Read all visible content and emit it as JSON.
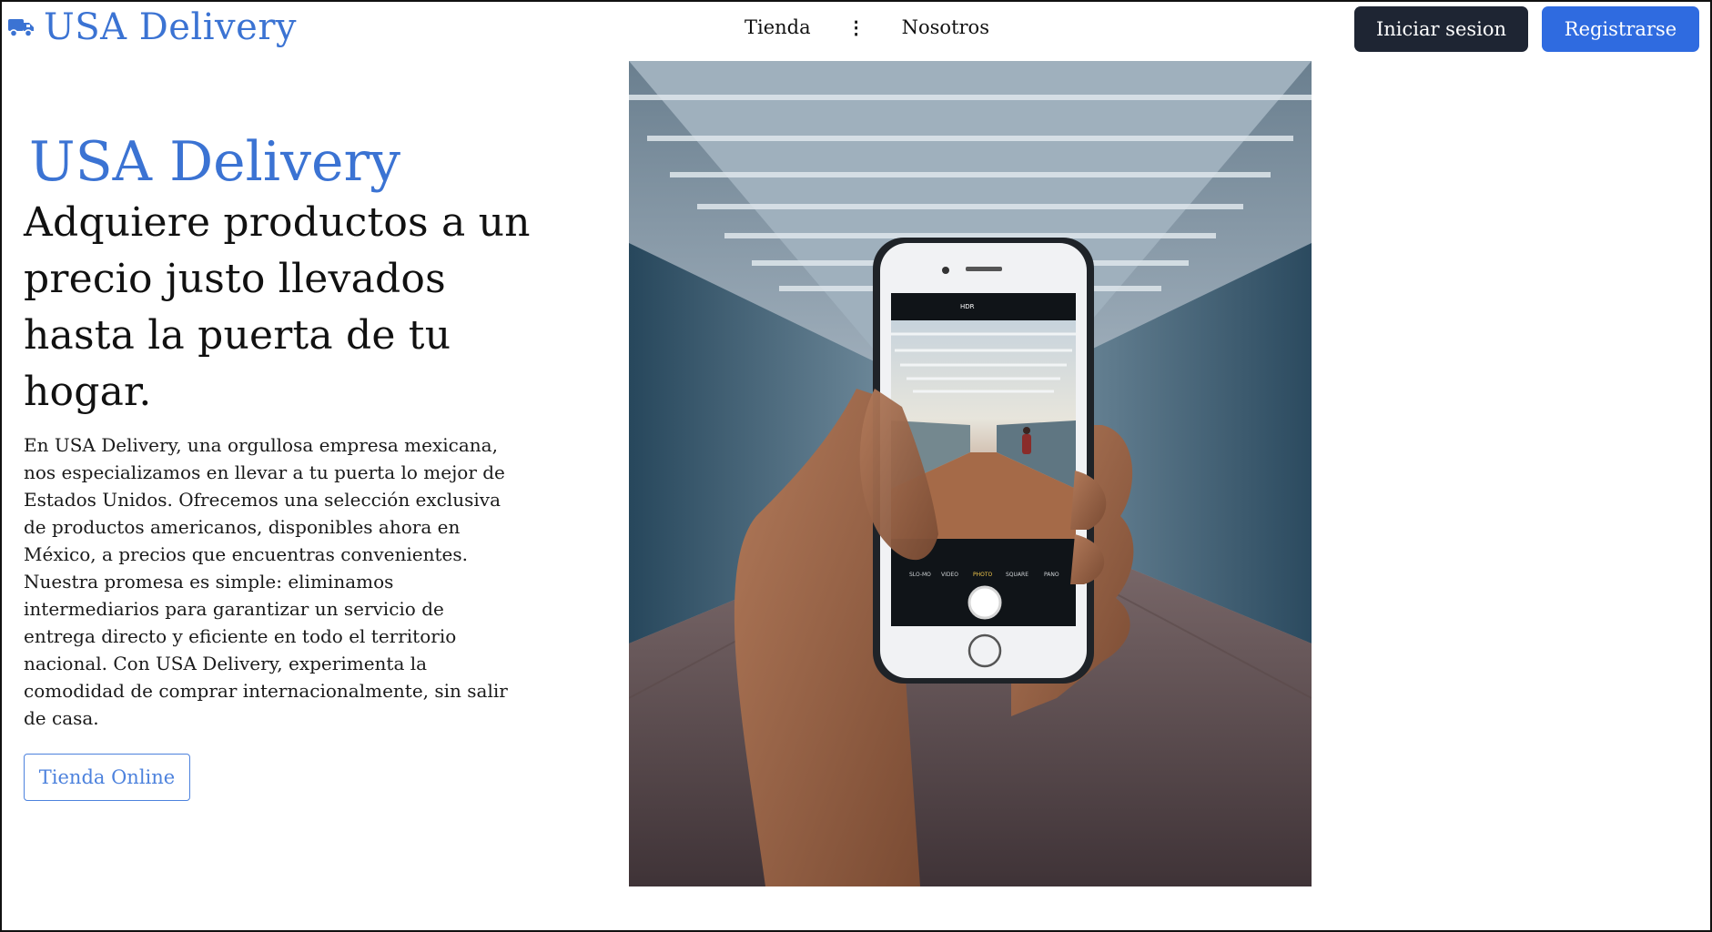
{
  "header": {
    "brand": "USA Delivery",
    "brand_icon": "truck-icon",
    "nav": {
      "store_label": "Tienda",
      "separator_icon": "vertical-dots-icon",
      "about_label": "Nosotros"
    },
    "login_label": "Iniciar sesion",
    "register_label": "Registrarse"
  },
  "hero": {
    "brand": "USA Delivery",
    "title": "Adquiere productos a un precio justo llevados hasta la puerta de tu hogar.",
    "description": "En USA Delivery, una orgullosa empresa mexicana, nos especializamos en llevar a tu puerta lo mejor de Estados Unidos. Ofrecemos una selección exclusiva de productos americanos, disponibles ahora en México, a precios que encuentras convenientes. Nuestra promesa es simple: eliminamos intermediarios para garantizar un servicio de entrega directo y eficiente en todo el territorio nacional. Con USA Delivery, experimenta la comodidad de comprar internacionalmente, sin salir de casa.",
    "cta_label": "Tienda Online",
    "image": {
      "camera_labels": {
        "hdr": "HDR",
        "modes": [
          "SLO-MO",
          "VIDEO",
          "PHOTO",
          "SQUARE",
          "PANO"
        ]
      }
    }
  },
  "colors": {
    "brand_blue": "#3b73d3",
    "login_bg": "#1e2533",
    "register_bg": "#2f6be0",
    "cta_border": "#4d82dd"
  }
}
